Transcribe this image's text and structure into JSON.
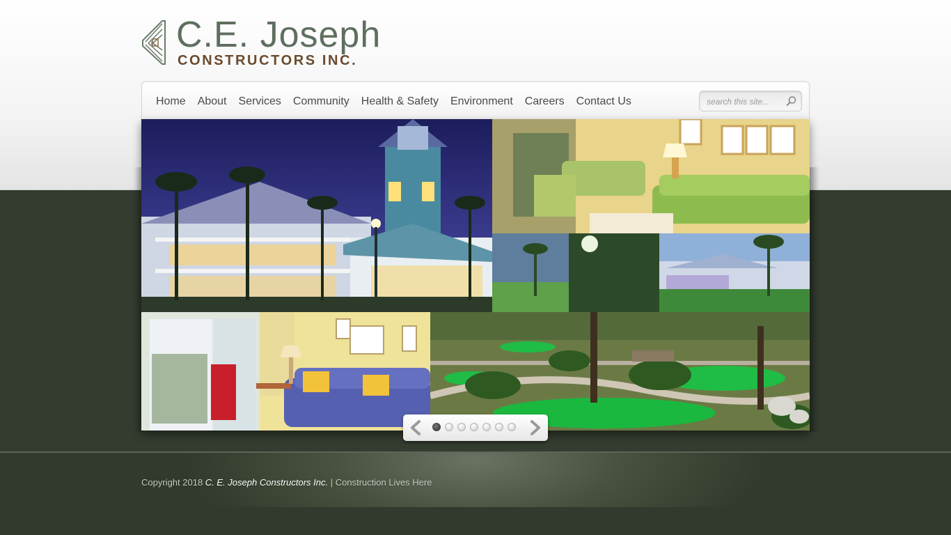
{
  "logo": {
    "line1": "C.E. Joseph",
    "line2": "CONSTRUCTORS INC.",
    "brand_green": "#5f6f5f",
    "brand_brown": "#6a4a2f"
  },
  "nav": {
    "items": [
      {
        "label": "Home"
      },
      {
        "label": "About"
      },
      {
        "label": "Services"
      },
      {
        "label": "Community"
      },
      {
        "label": "Health & Safety"
      },
      {
        "label": "Environment"
      },
      {
        "label": "Careers"
      },
      {
        "label": "Contact Us"
      }
    ]
  },
  "search": {
    "placeholder": "search this site...",
    "icon": "magnifier-icon"
  },
  "slider": {
    "slide_count": 7,
    "active_slide": 1,
    "prev_icon": "chevron-left-icon",
    "next_icon": "chevron-right-icon"
  },
  "footer": {
    "copyright_prefix": "Copyright 2018",
    "company": "C. E. Joseph Constructors Inc.",
    "separator": "|",
    "tagline": "Construction Lives Here"
  },
  "colors": {
    "background_dark": "#31392b",
    "footer_text": "#c8cbc2"
  }
}
